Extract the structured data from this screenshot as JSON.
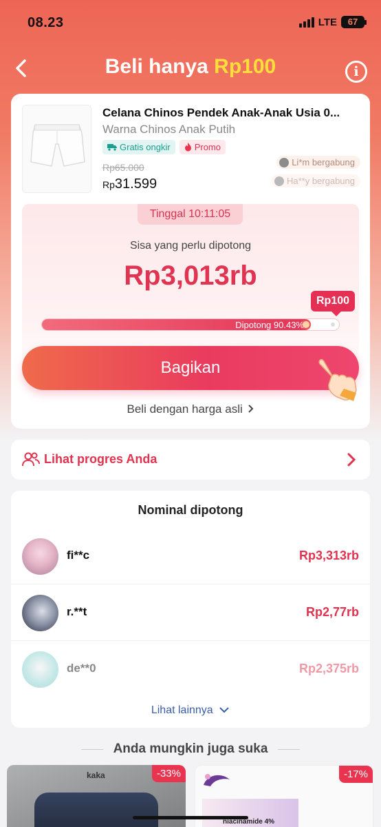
{
  "status_bar": {
    "time": "08.23",
    "network": "LTE",
    "battery": "67"
  },
  "header": {
    "title_prefix": "Beli hanya ",
    "title_accent": "Rp100"
  },
  "product": {
    "name": "Celana Chinos Pendek Anak-Anak Usia 0...",
    "variant": "Warna Chinos Anak Putih",
    "tag_shipping": "Gratis ongkir",
    "tag_promo": "Promo",
    "old_price": "Rp65.000",
    "price_currency": "Rp",
    "price_value": "31.599",
    "joined": [
      "Li*m bergabung",
      "Ha**y bergabung"
    ]
  },
  "cut": {
    "timer": "Tinggal 10:11:05",
    "remain_label": "Sisa yang perlu dipotong",
    "remain_value": "Rp3,013rb",
    "target_bubble": "Rp100",
    "progress_text": "Dipotong 90.43%",
    "progress_fraction": 0.9043,
    "share_label": "Bagikan",
    "buy_original": "Beli dengan harga asli"
  },
  "progress_link": {
    "label": "Lihat progres Anda"
  },
  "cut_list": {
    "title": "Nominal dipotong",
    "rows": [
      {
        "name": "fi**c",
        "amount": "Rp3,313rb"
      },
      {
        "name": "r.**t",
        "amount": "Rp2,77rb"
      },
      {
        "name": "de**0",
        "amount": "Rp2,375rb"
      }
    ],
    "more": "Lihat lainnya"
  },
  "recommendations": {
    "title": "Anda mungkin juga suka",
    "items": [
      {
        "discount": "-33%",
        "brand": "kaka"
      },
      {
        "discount": "-17%",
        "text": "niacinamide 4%"
      }
    ]
  },
  "colors": {
    "accent": "#e0334f",
    "header": "#ee6556",
    "title_accent": "#ffde3b"
  }
}
